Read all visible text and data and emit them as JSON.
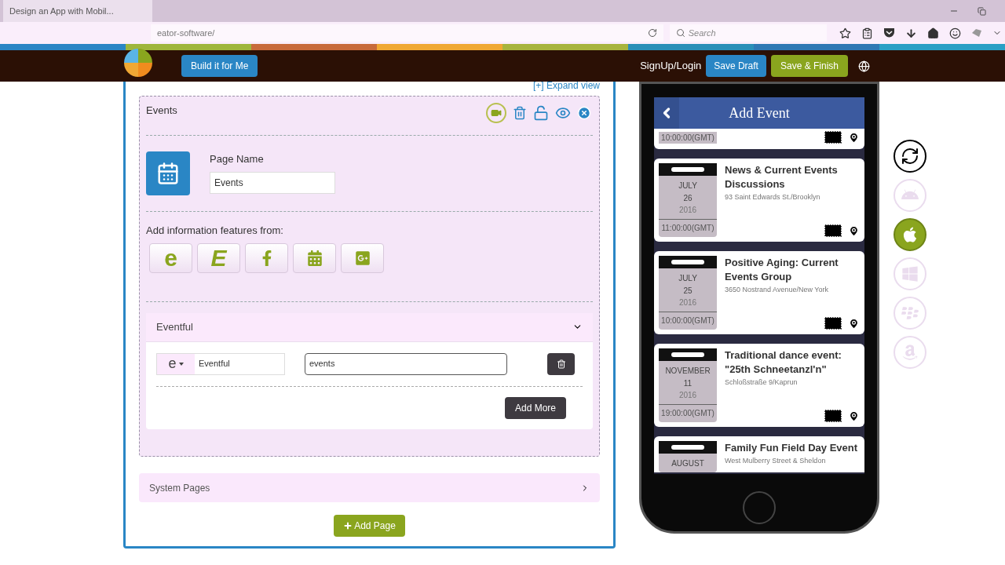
{
  "browser": {
    "tab_title": "Design an App with Mobil...",
    "url": "eator-software/",
    "search_placeholder": "Search"
  },
  "header": {
    "build_button": "Build it for Me",
    "login_link": "SignUp/Login",
    "draft_button": "Save Draft",
    "finish_button": "Save & Finish"
  },
  "editor": {
    "expand_link": "[+] Expand view",
    "page": {
      "title": "Events",
      "page_name_label": "Page Name",
      "page_name_value": "Events",
      "sources_label": "Add information features from:",
      "sources": [
        {
          "kind": "text",
          "label": "e"
        },
        {
          "kind": "text-italic",
          "label": "E"
        },
        {
          "kind": "facebook"
        },
        {
          "kind": "calendar"
        },
        {
          "kind": "google-plus"
        }
      ]
    },
    "feed": {
      "title": "Eventful",
      "expanded": true,
      "rows": [
        {
          "source_glyph": "e",
          "source_name": "Eventful",
          "query": "events"
        }
      ],
      "add_more": "Add More"
    },
    "system_pages": {
      "title": "System Pages",
      "expanded": false
    },
    "add_page": "Add Page"
  },
  "phone": {
    "title": "Add Event",
    "events": [
      {
        "kind": "partial",
        "time": "10:00:00(GMT)"
      },
      {
        "kind": "full",
        "month": "JULY",
        "day": "26",
        "year": "2016",
        "time": "11:00:00(GMT)",
        "title": "News & Current Events Discussions",
        "address": "93 Saint Edwards St./Brooklyn"
      },
      {
        "kind": "full",
        "month": "JULY",
        "day": "25",
        "year": "2016",
        "time": "10:00:00(GMT)",
        "title": "Positive Aging: Current Events Group",
        "address": "3650 Nostrand Avenue/New York"
      },
      {
        "kind": "full",
        "month": "NOVEMBER",
        "day": "11",
        "year": "2016",
        "time": "19:00:00(GMT)",
        "title": "Traditional dance event: \"25th Schneetanzl'n\"",
        "address": "Schloßstraße 9/Kaprun"
      },
      {
        "kind": "cut",
        "month": "AUGUST",
        "title": "Family Fun Field Day Event",
        "address": "West Mulberry Street & Sheldon"
      }
    ]
  },
  "platforms": [
    {
      "kind": "refresh",
      "selected": false
    },
    {
      "kind": "android",
      "selected": false
    },
    {
      "kind": "apple",
      "selected": true
    },
    {
      "kind": "windows",
      "selected": false
    },
    {
      "kind": "blackberry",
      "selected": false
    },
    {
      "kind": "amazon",
      "selected": false
    }
  ]
}
